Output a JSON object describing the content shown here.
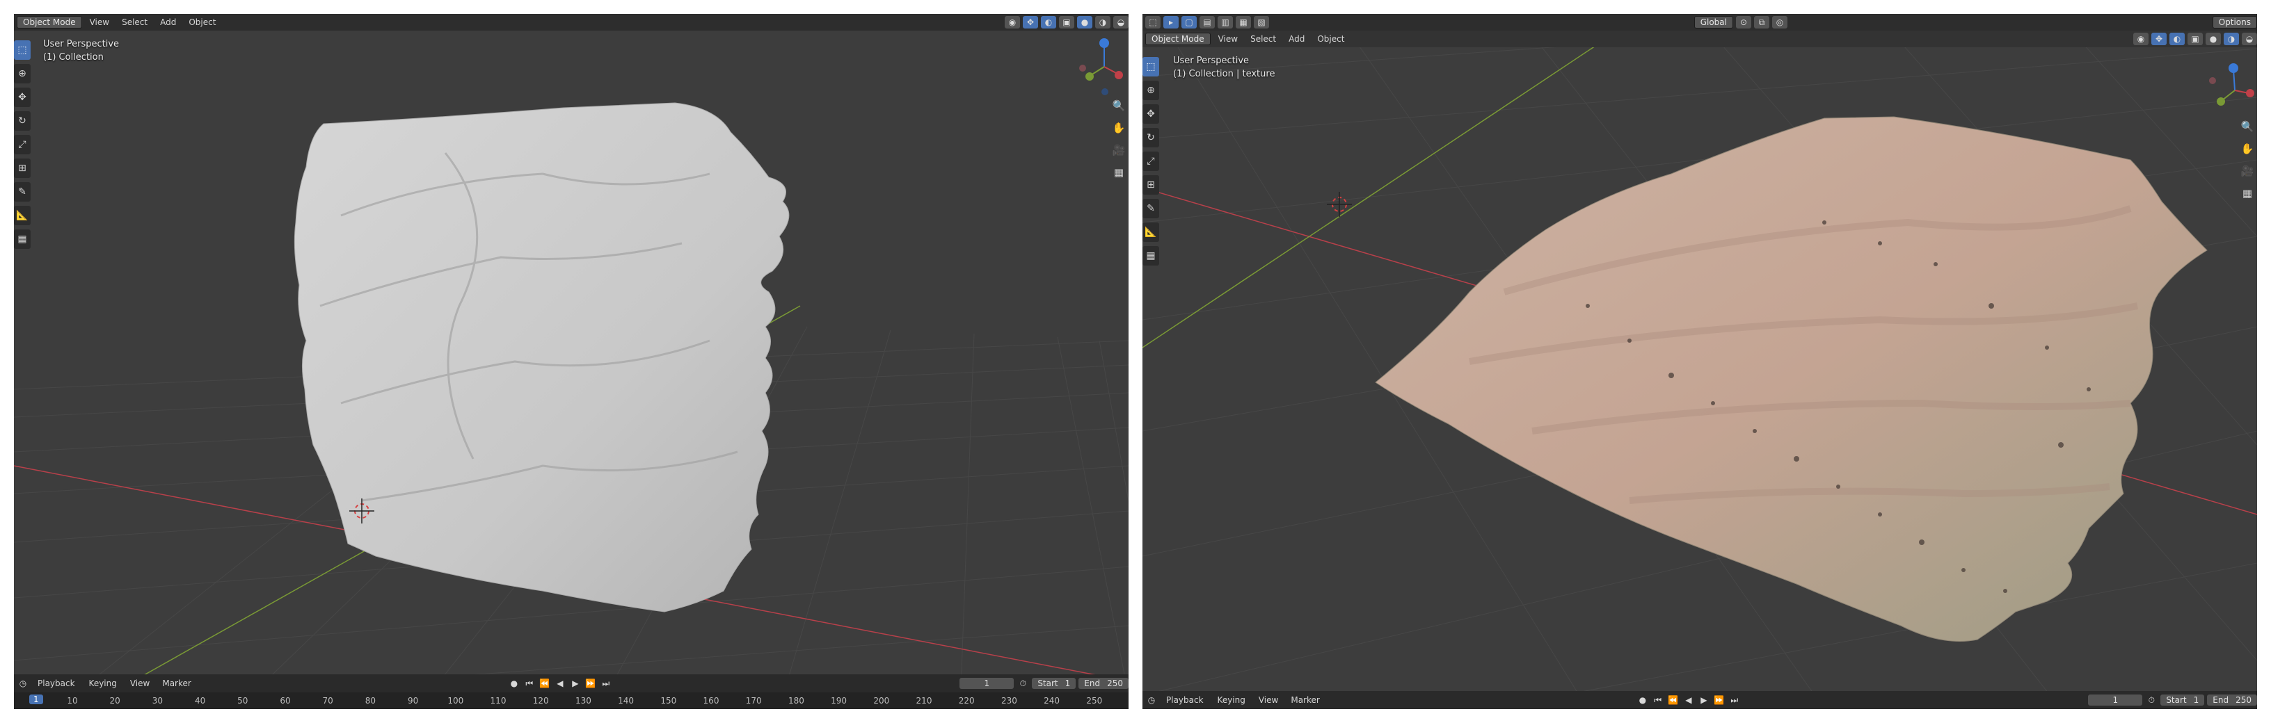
{
  "left_viewport": {
    "header": {
      "mode_label": "Object Mode",
      "menu": [
        "View",
        "Select",
        "Add",
        "Object"
      ]
    },
    "view_info": {
      "perspective": "User Perspective",
      "collection": "(1) Collection"
    },
    "toolbar_icons": [
      "select-box-icon",
      "cursor-icon",
      "move-icon",
      "rotate-icon",
      "scale-icon",
      "transform-icon",
      "annotate-icon",
      "measure-icon",
      "add-cube-icon"
    ],
    "timeline": {
      "menu": [
        "Playback",
        "Keying",
        "View",
        "Marker"
      ],
      "current_frame": "1",
      "start_label": "Start",
      "start_value": "1",
      "end_label": "End",
      "end_value": "250",
      "ruler_current": "1",
      "ruler_ticks": [
        "10",
        "20",
        "30",
        "40",
        "50",
        "60",
        "70",
        "80",
        "90",
        "100",
        "110",
        "120",
        "130",
        "140",
        "150",
        "160",
        "170",
        "180",
        "190",
        "200",
        "210",
        "220",
        "230",
        "240",
        "250"
      ]
    }
  },
  "right_viewport": {
    "top_header": {
      "orientation_label": "Global",
      "options_label": "Options"
    },
    "header": {
      "mode_label": "Object Mode",
      "menu": [
        "View",
        "Select",
        "Add",
        "Object"
      ]
    },
    "view_info": {
      "perspective": "User Perspective",
      "collection": "(1) Collection | texture"
    },
    "timeline": {
      "menu": [
        "Playback",
        "Keying",
        "View",
        "Marker"
      ],
      "current_frame": "1",
      "start_label": "Start",
      "start_value": "1",
      "end_label": "End",
      "end_value": "250"
    }
  },
  "colors": {
    "viewport_bg": "#3d3d3d",
    "header_bg": "#2d2d2d",
    "accent": "#4772b3",
    "axis_x": "#b8404a",
    "axis_y": "#7a9a35",
    "mesh_clay": "#c9c9c9",
    "mesh_sand": "#c4a493"
  }
}
